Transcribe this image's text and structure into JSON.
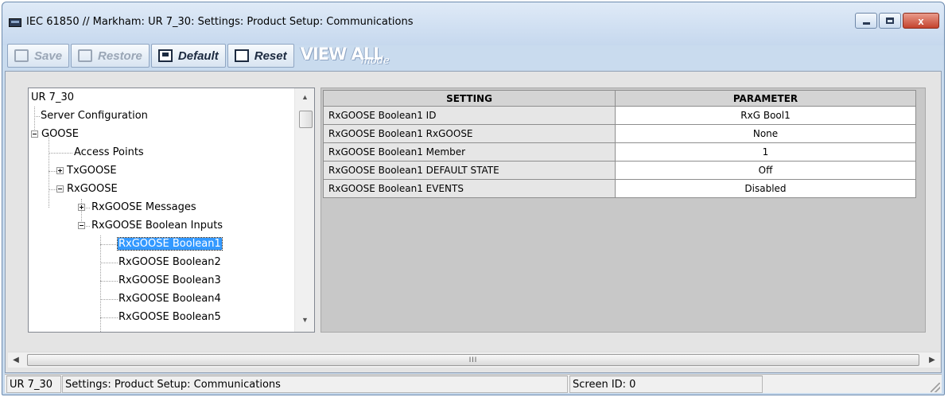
{
  "window": {
    "title": "IEC 61850 // Markham: UR 7_30: Settings: Product Setup: Communications",
    "close_glyph": "x"
  },
  "toolbar": {
    "save_label": "Save",
    "restore_label": "Restore",
    "default_label": "Default",
    "reset_label": "Reset",
    "viewall_label": "VIEW ALL",
    "viewall_mode": "mode"
  },
  "tree": {
    "nodes": [
      {
        "label": "UR 7_30",
        "icon": "none"
      },
      {
        "label": "Server Configuration",
        "icon": "leaf"
      },
      {
        "label": "GOOSE",
        "icon": "minus-icon"
      },
      {
        "label": "Access Points",
        "icon": "leaf"
      },
      {
        "label": "TxGOOSE",
        "icon": "plus-icon"
      },
      {
        "label": "RxGOOSE",
        "icon": "minus-icon"
      },
      {
        "label": "RxGOOSE Messages",
        "icon": "plus-icon"
      },
      {
        "label": "RxGOOSE Boolean Inputs",
        "icon": "minus-icon"
      },
      {
        "label": "RxGOOSE Boolean1",
        "icon": "leaf",
        "selected": true
      },
      {
        "label": "RxGOOSE Boolean2",
        "icon": "leaf"
      },
      {
        "label": "RxGOOSE Boolean3",
        "icon": "leaf"
      },
      {
        "label": "RxGOOSE Boolean4",
        "icon": "leaf"
      },
      {
        "label": "RxGOOSE Boolean5",
        "icon": "leaf"
      }
    ]
  },
  "grid": {
    "headers": [
      "SETTING",
      "PARAMETER"
    ],
    "rows": [
      {
        "setting": "RxGOOSE Boolean1 ID",
        "parameter": "RxG Bool1"
      },
      {
        "setting": "RxGOOSE Boolean1 RxGOOSE",
        "parameter": "None"
      },
      {
        "setting": "RxGOOSE Boolean1 Member",
        "parameter": "1"
      },
      {
        "setting": "RxGOOSE Boolean1 DEFAULT STATE",
        "parameter": "Off"
      },
      {
        "setting": "RxGOOSE Boolean1 EVENTS",
        "parameter": "Disabled"
      }
    ]
  },
  "hscroll": {
    "grip": "III"
  },
  "statusbar": {
    "device": "UR 7_30",
    "path": "Settings: Product Setup: Communications",
    "screen_id": "Screen ID: 0"
  },
  "colors": {
    "selection": "#3399ff",
    "title_gradient_top": "#dfeaf7",
    "close_button": "#c4442e"
  }
}
